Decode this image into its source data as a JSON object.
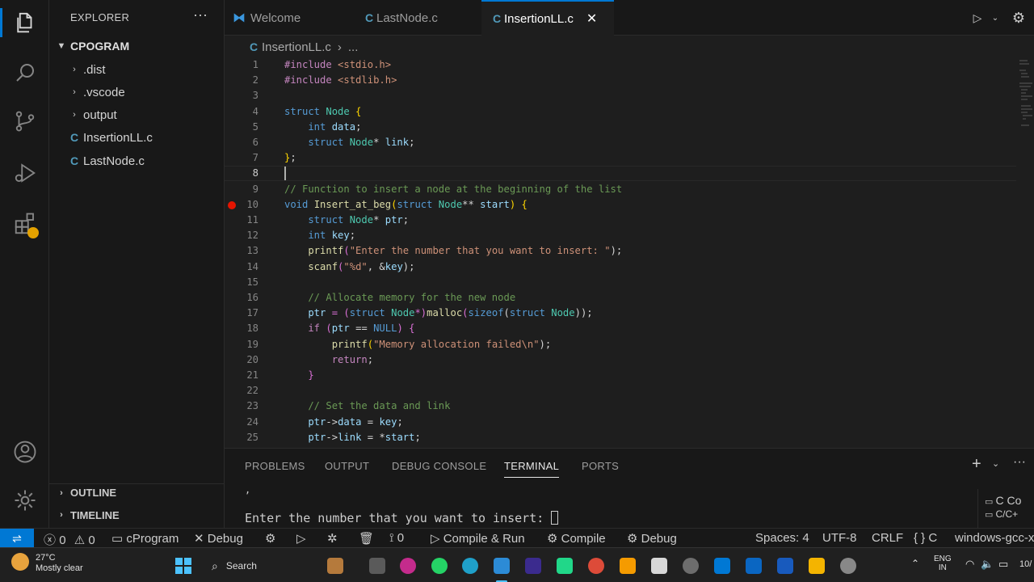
{
  "sidebar": {
    "title": "EXPLORER",
    "folder": "CPOGRAM",
    "items": [
      {
        "label": ".dist",
        "type": "folder"
      },
      {
        "label": ".vscode",
        "type": "folder"
      },
      {
        "label": "output",
        "type": "folder"
      },
      {
        "label": "InsertionLL.c",
        "type": "c-file"
      },
      {
        "label": "LastNode.c",
        "type": "c-file"
      }
    ],
    "outline": "OUTLINE",
    "timeline": "TIMELINE",
    "c_badge": "C"
  },
  "tabs": [
    {
      "label": "Welcome",
      "icon": "vscode-icon",
      "active": false
    },
    {
      "label": "LastNode.c",
      "icon": "c-icon",
      "active": false
    },
    {
      "label": "InsertionLL.c",
      "icon": "c-icon",
      "active": true
    }
  ],
  "tab_close": "✕",
  "breadcrumb": {
    "file": "InsertionLL.c",
    "sep": "›",
    "more": "..."
  },
  "editor": {
    "current_line": 8,
    "breakpoint_line": 10,
    "lines": [
      {
        "n": "1"
      },
      {
        "n": "2"
      },
      {
        "n": "3"
      },
      {
        "n": "4"
      },
      {
        "n": "5"
      },
      {
        "n": "6"
      },
      {
        "n": "7"
      },
      {
        "n": "8"
      },
      {
        "n": "9"
      },
      {
        "n": "10"
      },
      {
        "n": "11"
      },
      {
        "n": "12"
      },
      {
        "n": "13"
      },
      {
        "n": "14"
      },
      {
        "n": "15"
      },
      {
        "n": "16"
      },
      {
        "n": "17"
      },
      {
        "n": "18"
      },
      {
        "n": "19"
      },
      {
        "n": "20"
      },
      {
        "n": "21"
      },
      {
        "n": "22"
      },
      {
        "n": "23"
      },
      {
        "n": "24"
      },
      {
        "n": "25"
      }
    ],
    "code": {
      "l1a": "#include",
      "l1b": " <stdio.h>",
      "l2a": "#include",
      "l2b": " <stdlib.h>",
      "l4a": "struct",
      "l4b": " Node",
      "l4c": " {",
      "l5a": "    int",
      "l5b": " data",
      "l5c": ";",
      "l6a": "    struct",
      "l6b": " Node",
      "l6c": "*",
      "l6d": " link",
      "l6e": ";",
      "l7a": "}",
      "l7b": ";",
      "l9": "// Function to insert a node at the beginning of the list",
      "l10a": "void",
      "l10b": " Insert_at_beg",
      "l10c": "(",
      "l10d": "struct",
      "l10e": " Node",
      "l10f": "**",
      "l10g": " start",
      "l10h": ")",
      "l10i": " {",
      "l11a": "    struct",
      "l11b": " Node",
      "l11c": "*",
      "l11d": " ptr",
      "l11e": ";",
      "l12a": "    int",
      "l12b": " key",
      "l12c": ";",
      "l13a": "    printf",
      "l13b": "(",
      "l13c": "\"Enter the number that you want to insert: \"",
      "l13d": ");",
      "l14a": "    scanf",
      "l14b": "(",
      "l14c": "\"%d\"",
      "l14d": ", &",
      "l14e": "key",
      "l14f": ");",
      "l16": "    // Allocate memory for the new node",
      "l17a": "    ptr",
      "l17b": " = (",
      "l17c": "struct",
      "l17d": " Node",
      "l17e": "*)",
      "l17f": "malloc",
      "l17g": "(",
      "l17h": "sizeof",
      "l17i": "(",
      "l17j": "struct",
      "l17k": " Node",
      "l17l": "));",
      "l18a": "    if",
      "l18b": " (",
      "l18c": "ptr",
      "l18d": " == ",
      "l18e": "NULL",
      "l18f": ") {",
      "l19a": "        printf",
      "l19b": "(",
      "l19c": "\"Memory allocation failed\\n\"",
      "l19d": ");",
      "l20a": "        return",
      "l20b": ";",
      "l21": "    }",
      "l23": "    // Set the data and link",
      "l24a": "    ptr",
      "l24b": "->",
      "l24c": "data",
      "l24d": " = ",
      "l24e": "key",
      "l24f": ";",
      "l25a": "    ptr",
      "l25b": "->",
      "l25c": "link",
      "l25d": " = *",
      "l25e": "start",
      "l25f": ";"
    }
  },
  "panel": {
    "tabs": [
      "PROBLEMS",
      "OUTPUT",
      "DEBUG CONSOLE",
      "TERMINAL",
      "PORTS"
    ],
    "active_tab": "TERMINAL",
    "terminal_prev": ",",
    "terminal_prompt": "Enter the number that you want to insert: ",
    "side_items": [
      "C Co",
      "C/C+"
    ],
    "add": "+"
  },
  "statusbar": {
    "errors": "0",
    "warnings": "0",
    "project": "cProgram",
    "debug": "Debug",
    "ports": "0",
    "compile_run": "Compile & Run",
    "compile": "Compile",
    "debug2": "Debug",
    "spaces": "Spaces: 4",
    "encoding": "UTF-8",
    "eol": "CRLF",
    "language": "{ }  C",
    "config": "windows-gcc-x"
  },
  "taskbar": {
    "temperature": "27°C",
    "weather": "Mostly clear",
    "search": "Search",
    "lang": "ENG",
    "region": "IN",
    "time_partial": "10/"
  },
  "colors": {
    "accent": "#0078d4",
    "breakpoint": "#e51400"
  }
}
